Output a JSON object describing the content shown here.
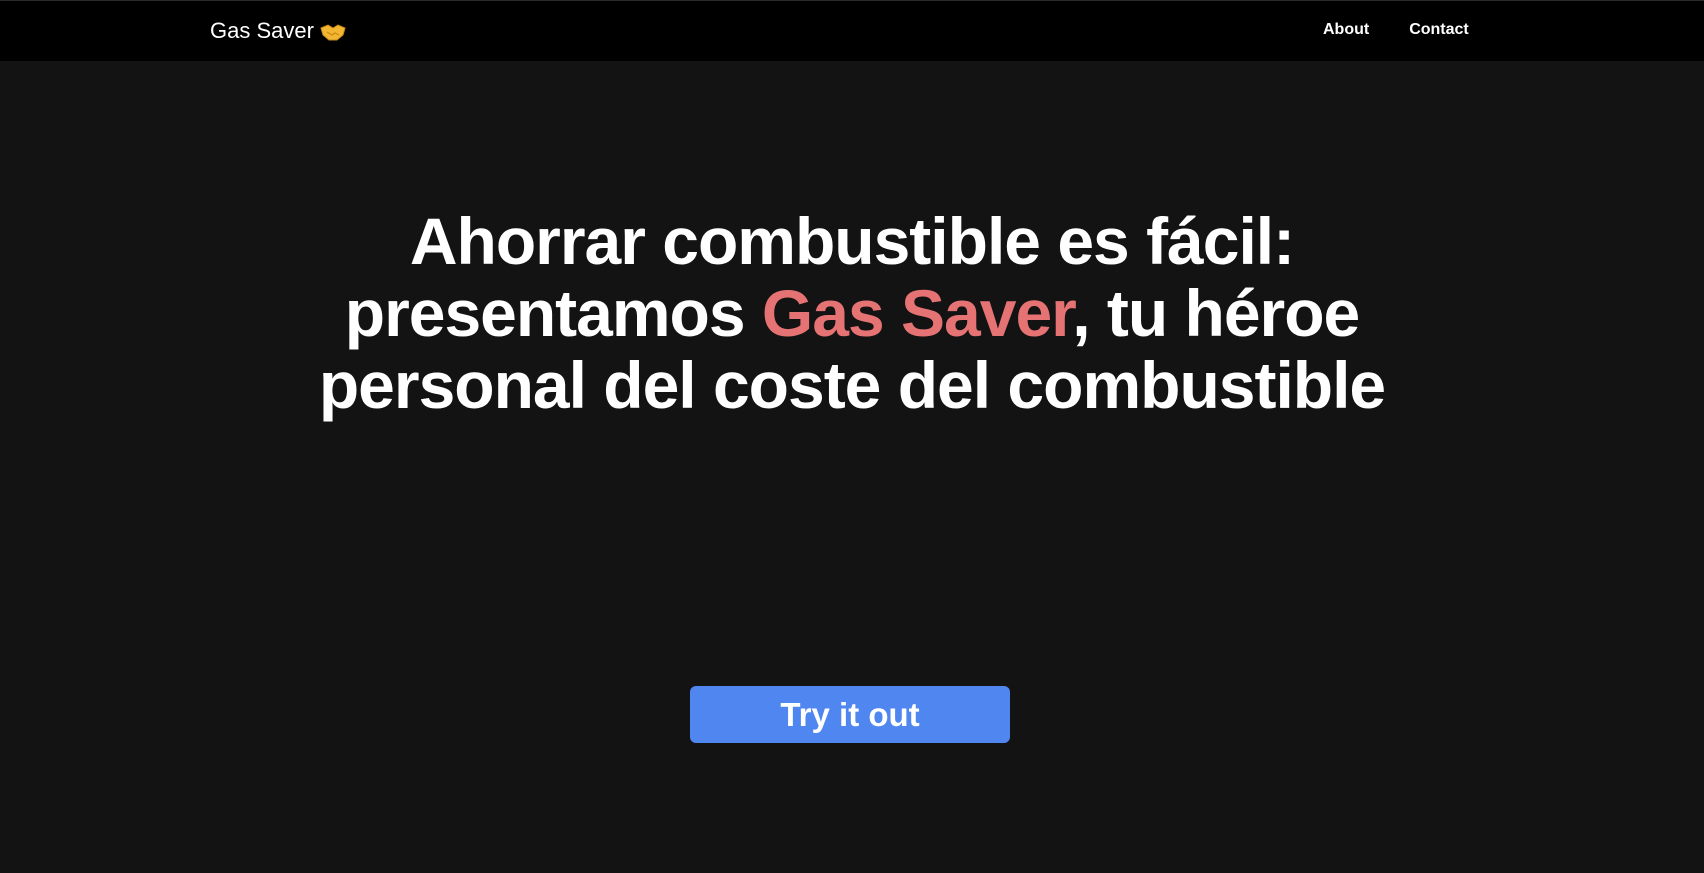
{
  "navbar": {
    "brand": "Gas Saver",
    "brand_icon": "handshake-icon",
    "links": [
      {
        "label": "About"
      },
      {
        "label": "Contact"
      }
    ]
  },
  "hero": {
    "headline_before": "Ahorrar combustible es fácil: presentamos ",
    "headline_highlight": "Gas Saver",
    "headline_after": ", tu héroe personal del coste del combustible",
    "cta_label": "Try it out"
  },
  "colors": {
    "background": "#131313",
    "navbar": "#000000",
    "highlight": "#e57373",
    "cta": "#4f86f0"
  }
}
